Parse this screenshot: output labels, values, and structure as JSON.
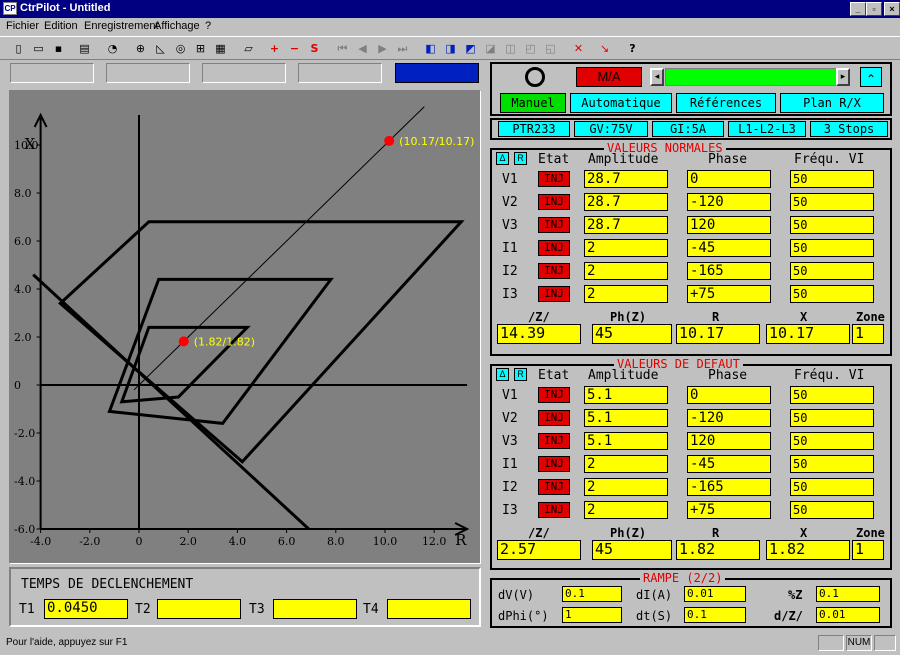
{
  "app": {
    "title": "CtrPilot - Untitled"
  },
  "window_buttons": {
    "minimize": "_",
    "maximize": "▫",
    "close": "×"
  },
  "menu": {
    "items": [
      "Fichier",
      "Edition",
      "Enregistrement",
      "Affichage",
      "?"
    ]
  },
  "toolbar": {
    "plus": "+",
    "minus": "−",
    "s": "S",
    "cross": "✕",
    "help": "?"
  },
  "status": {
    "help_text": "Pour l'aide, appuyez sur F1",
    "num": "NUM"
  },
  "chart_data": {
    "type": "scatter",
    "xlabel": "R",
    "ylabel": "X",
    "xlim": [
      -4.0,
      13.5
    ],
    "ylim": [
      -6.0,
      11.5
    ],
    "x_ticks": [
      "-4.0",
      "-2.0",
      "0",
      "2.0",
      "4.0",
      "6.0",
      "8.0",
      "10.0",
      "12.0"
    ],
    "y_ticks": [
      "10.0",
      "8.0",
      "6.0",
      "4.0",
      "2.0",
      "0",
      "-2.0",
      "-4.0",
      "-6.0"
    ],
    "points": [
      {
        "x": 10.17,
        "y": 10.17,
        "label": "(10.17/10.17)"
      },
      {
        "x": 1.82,
        "y": 1.82,
        "label": "(1.82/1.82)"
      }
    ],
    "zones": [
      {
        "corners": [
          [
            -0.7,
            -0.7
          ],
          [
            0.4,
            2.4
          ],
          [
            4.4,
            2.4
          ],
          [
            1.6,
            -0.5
          ]
        ]
      },
      {
        "corners": [
          [
            -1.2,
            -1.1
          ],
          [
            0.8,
            4.4
          ],
          [
            7.8,
            4.4
          ],
          [
            3.4,
            -1.6
          ]
        ]
      },
      {
        "corners": [
          [
            -3.2,
            3.4
          ],
          [
            0.4,
            6.8
          ],
          [
            13.1,
            6.8
          ],
          [
            4.2,
            -3.2
          ]
        ]
      }
    ]
  },
  "trip_time": {
    "title": "TEMPS DE DECLENCHEMENT",
    "t1_label": "T1",
    "t1_value": "0.0450",
    "t2_label": "T2",
    "t2_value": "",
    "t3_label": "T3",
    "t3_value": "",
    "t4_label": "T4",
    "t4_value": ""
  },
  "controls": {
    "ma_label": "M/A",
    "scroll_left": "◂",
    "scroll_right": "▸",
    "up_btn": "⌃",
    "tabs": [
      "Manuel",
      "Automatique",
      "Références",
      "Plan R/X"
    ],
    "status_btns": [
      "PTR233",
      "GV:75V",
      "GI:5A",
      "L1-L2-L3",
      "3 Stops"
    ]
  },
  "normales": {
    "title": "VALEURS NORMALES",
    "headers": {
      "delta": "Δ",
      "r": "R",
      "etat": "Etat",
      "amp": "Amplitude",
      "phase": "Phase",
      "freq": "Fréqu. VI"
    },
    "rows": [
      {
        "name": "V1",
        "etat": "INJ",
        "amp": "28.7",
        "phase": "0",
        "freq": "50"
      },
      {
        "name": "V2",
        "etat": "INJ",
        "amp": "28.7",
        "phase": "-120",
        "freq": "50"
      },
      {
        "name": "V3",
        "etat": "INJ",
        "amp": "28.7",
        "phase": "120",
        "freq": "50"
      },
      {
        "name": "I1",
        "etat": "INJ",
        "amp": "2",
        "phase": "-45",
        "freq": "50"
      },
      {
        "name": "I2",
        "etat": "INJ",
        "amp": "2",
        "phase": "-165",
        "freq": "50"
      },
      {
        "name": "I3",
        "etat": "INJ",
        "amp": "2",
        "phase": "+75",
        "freq": "50"
      }
    ],
    "summary_labels": [
      "/Z/",
      "Ph(Z)",
      "R",
      "X",
      "Zone"
    ],
    "summary_values": [
      "14.39",
      "45",
      "10.17",
      "10.17",
      "1"
    ]
  },
  "defaut": {
    "title": "VALEURS DE DEFAUT",
    "headers": {
      "delta": "Δ",
      "r": "R",
      "etat": "Etat",
      "amp": "Amplitude",
      "phase": "Phase",
      "freq": "Fréqu. VI"
    },
    "rows": [
      {
        "name": "V1",
        "etat": "INJ",
        "amp": "5.1",
        "phase": "0",
        "freq": "50"
      },
      {
        "name": "V2",
        "etat": "INJ",
        "amp": "5.1",
        "phase": "-120",
        "freq": "50"
      },
      {
        "name": "V3",
        "etat": "INJ",
        "amp": "5.1",
        "phase": "120",
        "freq": "50"
      },
      {
        "name": "I1",
        "etat": "INJ",
        "amp": "2",
        "phase": "-45",
        "freq": "50"
      },
      {
        "name": "I2",
        "etat": "INJ",
        "amp": "2",
        "phase": "-165",
        "freq": "50"
      },
      {
        "name": "I3",
        "etat": "INJ",
        "amp": "2",
        "phase": "+75",
        "freq": "50"
      }
    ],
    "summary_labels": [
      "/Z/",
      "Ph(Z)",
      "R",
      "X",
      "Zone"
    ],
    "summary_values": [
      "2.57",
      "45",
      "1.82",
      "1.82",
      "1"
    ]
  },
  "rampe": {
    "title": "RAMPE (2/2)",
    "dv_label": "dV(V)",
    "dv_value": "0.1",
    "di_label": "dI(A)",
    "di_value": "0.01",
    "pz_label": "%Z",
    "pz_value": "0.1",
    "dphi_label": "dPhi(°)",
    "dphi_value": "1",
    "dt_label": "dt(S)",
    "dt_value": "0.1",
    "dz_label": "d/Z/",
    "dz_value": "0.01"
  },
  "colors": {
    "title_bg": "#000080",
    "accent_blue": "#0020c0",
    "yellow": "#ffff00",
    "cyan": "#00ffff",
    "green": "#00ff00",
    "red": "#e00000",
    "plot_bg": "#808080",
    "marker": "#ff0000"
  }
}
